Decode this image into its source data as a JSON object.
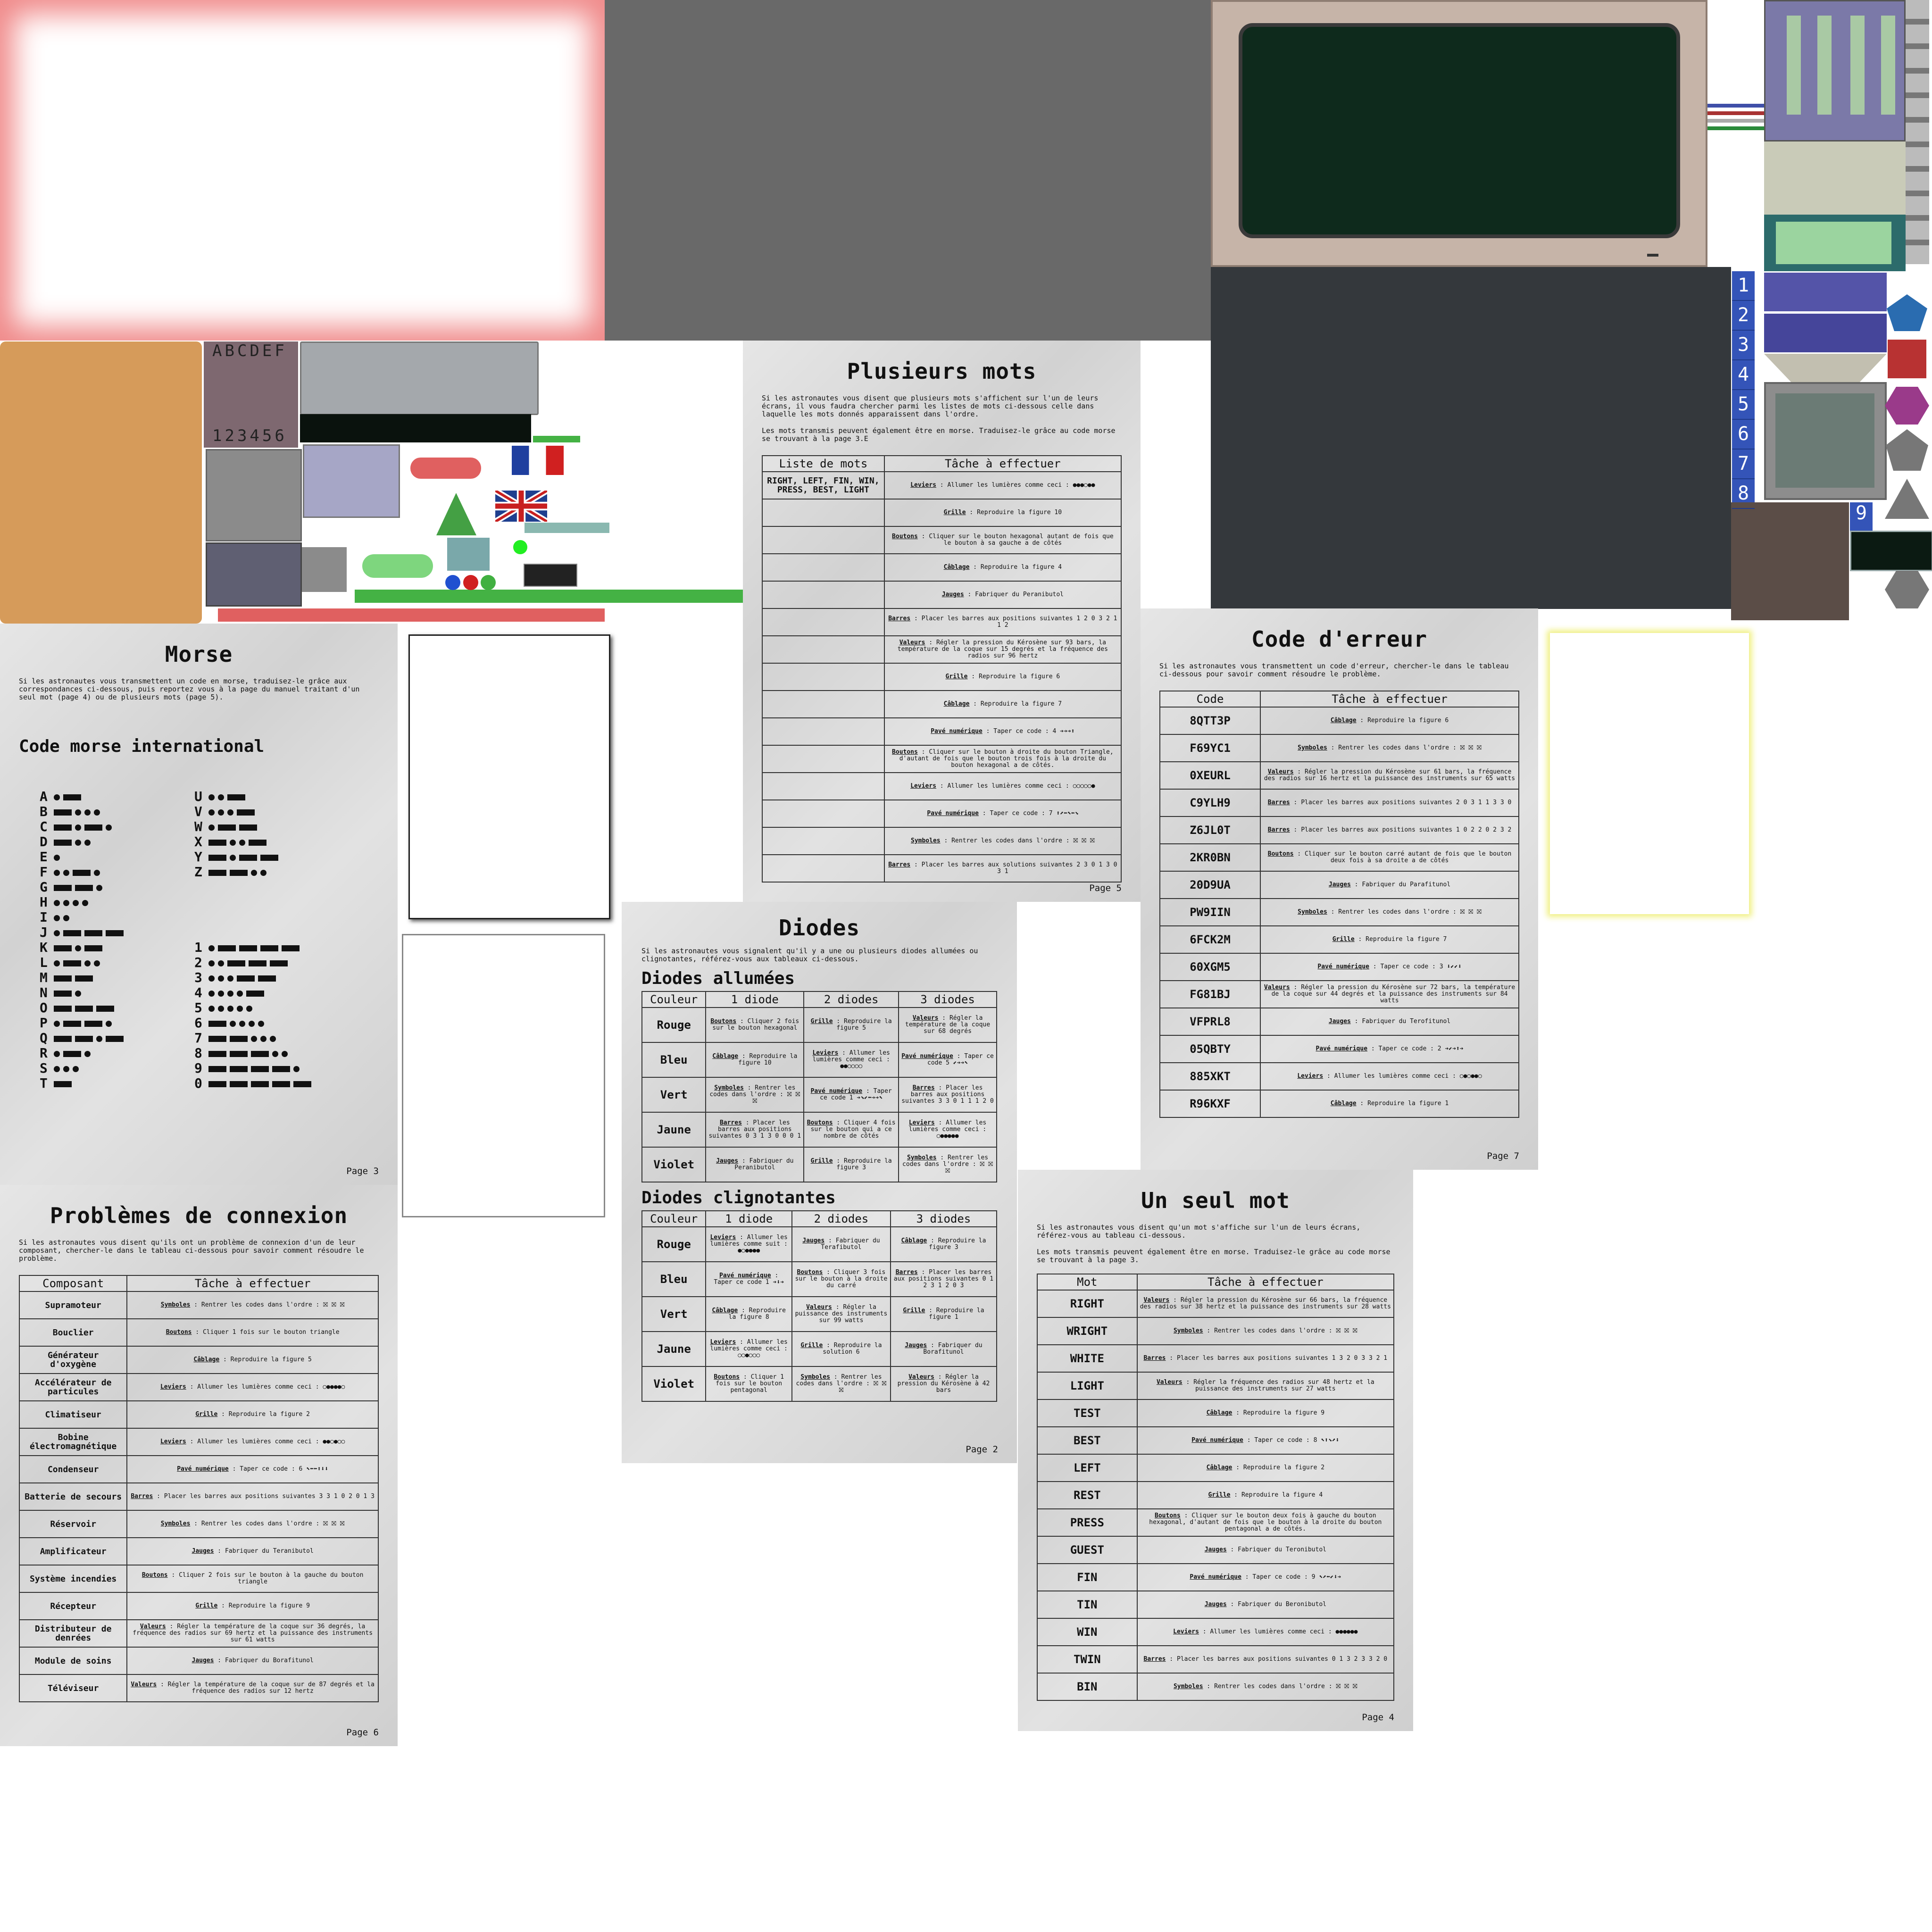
{
  "atlas": {
    "keypad_letters": "ABCDEF",
    "keypad_numbers": "123456",
    "side_numbers": [
      "1",
      "2",
      "3",
      "4",
      "5",
      "6",
      "7",
      "8",
      "9"
    ]
  },
  "morse": {
    "title": "Morse",
    "intro": "Si les astronautes vous transmettent un code en morse, traduisez-le grâce aux correspondances ci-dessous, puis reportez vous à la page du manuel traitant d'un seul mot (page 4) ou de plusieurs mots (page 5).",
    "subtitle": "Code morse international",
    "page": "Page 3",
    "letters_left": [
      "A",
      "B",
      "C",
      "D",
      "E",
      "F",
      "G",
      "H",
      "I",
      "J",
      "K",
      "L",
      "M",
      "N",
      "O",
      "P",
      "Q",
      "R",
      "S",
      "T"
    ],
    "codes_left": [
      ".-",
      "-...",
      "-.-.",
      "-..",
      ".",
      "..-.",
      "--.",
      "....",
      "..",
      ".---",
      "-.-",
      ".-..",
      "--",
      "-.",
      "---",
      ".--.",
      "--.-",
      ".-.",
      "...",
      "-"
    ],
    "letters_right": [
      "U",
      "V",
      "W",
      "X",
      "Y",
      "Z"
    ],
    "codes_right": [
      "..-",
      "...-",
      ".--",
      "-..-",
      "-.--",
      "--.."
    ],
    "digits": [
      "1",
      "2",
      "3",
      "4",
      "5",
      "6",
      "7",
      "8",
      "9",
      "0"
    ],
    "codes_digits": [
      ".----",
      "..---",
      "...--",
      "....-",
      ".....",
      "-....",
      "--...",
      "---..",
      "----.",
      "-----"
    ]
  },
  "connexion": {
    "title": "Problèmes de connexion",
    "intro": "Si les astronautes vous disent qu'ils ont un problème de connexion d'un de leur composant, chercher-le dans le tableau ci-dessous pour savoir comment résoudre le problème.",
    "col1": "Composant",
    "col2": "Tâche à effectuer",
    "page": "Page 6",
    "rows": [
      {
        "k": "Supramoteur",
        "t": "Symboles",
        "d": " : Rentrer les codes dans l'ordre : ⛝ ⛝ ⛝"
      },
      {
        "k": "Bouclier",
        "t": "Boutons",
        "d": " : Cliquer 1 fois sur le bouton triangle"
      },
      {
        "k": "Générateur d'oxygène",
        "t": "Câblage",
        "d": " : Reproduire la figure 5"
      },
      {
        "k": "Accélérateur de particules",
        "t": "Leviers",
        "d": " : Allumer les lumières comme ceci : ○●●●●○"
      },
      {
        "k": "Climatiseur",
        "t": "Grille",
        "d": " : Reproduire la figure 2"
      },
      {
        "k": "Bobine électromagnétique",
        "t": "Leviers",
        "d": " : Allumer les lumières comme ceci : ●●○●○○"
      },
      {
        "k": "Condenseur",
        "t": "Pavé numérique",
        "d": " : Taper ce code : 6 ⬉⬅⬅⬆⬇⬇"
      },
      {
        "k": "Batterie de secours",
        "t": "Barres",
        "d": " : Placer les barres aux positions suivantes 3 3 1 0 2 0 1 3"
      },
      {
        "k": "Réservoir",
        "t": "Symboles",
        "d": " : Rentrer les codes dans l'ordre : ⛝ ⛝ ⛝"
      },
      {
        "k": "Amplificateur",
        "t": "Jauges",
        "d": " : Fabriquer du Teranibutol"
      },
      {
        "k": "Système incendies",
        "t": "Boutons",
        "d": " : Cliquer 2 fois sur le bouton à la gauche du bouton triangle"
      },
      {
        "k": "Récepteur",
        "t": "Grille",
        "d": " : Reproduire la figure 9"
      },
      {
        "k": "Distributeur de denrées",
        "t": "Valeurs",
        "d": " : Régler la température de la coque sur 36 degrés, la fréquence des radios sur 69 hertz et la puissance des instruments sur 61 watts"
      },
      {
        "k": "Module de soins",
        "t": "Jauges",
        "d": " : Fabriquer du Borafitunol"
      },
      {
        "k": "Téléviseur",
        "t": "Valeurs",
        "d": " : Régler la température de la coque sur de 87 degrés et la fréquence des radios sur 12 hertz"
      }
    ]
  },
  "plusieurs": {
    "title": "Plusieurs mots",
    "intro1": "Si les astronautes vous disent que plusieurs mots s'affichent sur l'un de leurs écrans, il vous faudra chercher parmi les listes de mots ci-dessous celle dans laquelle les mots donnés apparaissent dans l'ordre.",
    "intro2": "Les mots transmis peuvent également être en morse. Traduisez-le grâce au code morse se trouvant à la page 3.E",
    "col1": "Liste de mots",
    "col2": "Tâche à effectuer",
    "page": "Page 5",
    "rows": [
      {
        "k": "RIGHT, LEFT, FIN, WIN, PRESS, BEST, LIGHT",
        "t": "Leviers",
        "d": " : Allumer les lumières comme ceci : ●●●○●●"
      },
      {
        "k": "",
        "t": "Grille",
        "d": " : Reproduire la figure 10"
      },
      {
        "k": "",
        "t": "Boutons",
        "d": " : Cliquer sur le bouton hexagonal autant de fois que le bouton à sa gauche a de côtés"
      },
      {
        "k": "",
        "t": "Câblage",
        "d": " : Reproduire la figure 4"
      },
      {
        "k": "",
        "t": "Jauges",
        "d": " : Fabriquer du Peranibutol"
      },
      {
        "k": "",
        "t": "Barres",
        "d": " : Placer les barres aux positions suivantes 1 2 0 3 2 1 1 2"
      },
      {
        "k": "",
        "t": "Valeurs",
        "d": " : Régler la pression du Kérosène sur 93 bars, la température de la coque sur 15 degrés et la fréquence des radios sur 96 hertz"
      },
      {
        "k": "",
        "t": "Grille",
        "d": " : Reproduire la figure 6"
      },
      {
        "k": "",
        "t": "Câblage",
        "d": " : Reproduire la figure 7"
      },
      {
        "k": "",
        "t": "Pavé numérique",
        "d": " : Taper ce code : 4 ➔➔➔⬆"
      },
      {
        "k": "",
        "t": "Boutons",
        "d": " : Cliquer sur le bouton à droite du bouton Triangle, d'autant de fois que le bouton trois fois à la droite du bouton hexagonal a de côtés."
      },
      {
        "k": "",
        "t": "Leviers",
        "d": " : Allumer les lumières comme ceci : ○○○○○●"
      },
      {
        "k": "",
        "t": "Pavé numérique",
        "d": " : Taper ce code : 7 ⬆⬈⬅⬉⬅⬊"
      },
      {
        "k": "",
        "t": "Symboles",
        "d": " : Rentrer les codes dans l'ordre : ⛝ ⛝ ⛝"
      },
      {
        "k": "",
        "t": "Barres",
        "d": " : Placer les barres aux solutions suivantes 2 3 0 1 3 0 3 1"
      }
    ]
  },
  "diodes": {
    "title": "Diodes",
    "intro": "Si les astronautes vous signalent qu'il y a une ou plusieurs diodes allumées ou clignotantes, référez-vous aux tableaux ci-dessous.",
    "sub1": "Diodes allumées",
    "sub2": "Diodes clignotantes",
    "cols": [
      "Couleur",
      "1 diode",
      "2 diodes",
      "3 diodes"
    ],
    "page": "Page 2",
    "lit": [
      {
        "k": "Rouge",
        "c": [
          [
            "Boutons",
            " : Cliquer 2 fois sur le bouton hexagonal"
          ],
          [
            "Grille",
            " : Reproduire la figure 5"
          ],
          [
            "Valeurs",
            " : Régler la température de la coque sur 68 degrés"
          ]
        ]
      },
      {
        "k": "Bleu",
        "c": [
          [
            "Câblage",
            " : Reproduire la figure 10"
          ],
          [
            "Leviers",
            " : Allumer les lumières comme ceci : ●●○○○○"
          ],
          [
            "Pavé numérique",
            " : Taper ce code 5 ⬋➔➔⬉"
          ]
        ]
      },
      {
        "k": "Vert",
        "c": [
          [
            "Symboles",
            " : Rentrer les codes dans l'ordre : ⛝ ⛝ ⛝"
          ],
          [
            "Pavé numérique",
            " : Taper ce code 1 ➔⬊⬋⬅➔➔⬉"
          ],
          [
            "Barres",
            " : Placer les barres aux positions suivantes 3 3 0 1 1 1 2 0"
          ]
        ]
      },
      {
        "k": "Jaune",
        "c": [
          [
            "Barres",
            " : Placer les barres aux positions suivantes 0 3 1 3 0 0 0 1"
          ],
          [
            "Boutons",
            " : Cliquer 4 fois sur le bouton qui a ce nombre de côtés"
          ],
          [
            "Leviers",
            " : Allumer les lumières comme ceci : ○●●●●●"
          ]
        ]
      },
      {
        "k": "Violet",
        "c": [
          [
            "Jauges",
            " : Fabriquer du Peranibutol"
          ],
          [
            "Grille",
            " : Reproduire la figure 3"
          ],
          [
            "Symboles",
            " : Rentrer les codes dans l'ordre : ⛝ ⛝ ⛝"
          ]
        ]
      }
    ],
    "blink": [
      {
        "k": "Rouge",
        "c": [
          [
            "Leviers",
            " : Allumer les lumières comme suit : ●○●●●●"
          ],
          [
            "Jauges",
            " : Fabriquer du Terafibutol"
          ],
          [
            "Câblage",
            " : Reproduire la figure 3"
          ]
        ]
      },
      {
        "k": "Bleu",
        "c": [
          [
            "Pavé numérique",
            " : Taper ce code 1 ➔⬇➔"
          ],
          [
            "Boutons",
            " : Cliquer 3 fois sur le bouton à la droite du carré"
          ],
          [
            "Barres",
            " : Placer les barres aux positions suivantes 0 1 2 3 1 2 0 3"
          ]
        ]
      },
      {
        "k": "Vert",
        "c": [
          [
            "Câblage",
            " : Reproduire la figure 8"
          ],
          [
            "Valeurs",
            " : Régler la puissance des instruments sur 99 watts"
          ],
          [
            "Grille",
            " : Reproduire la figure 1"
          ]
        ]
      },
      {
        "k": "Jaune",
        "c": [
          [
            "Leviers",
            " : Allumer les lumières comme ceci : ○○●○○○"
          ],
          [
            "Grille",
            " : Reproduire la solution 6"
          ],
          [
            "Jauges",
            " : Fabriquer du Borafitunol"
          ]
        ]
      },
      {
        "k": "Violet",
        "c": [
          [
            "Boutons",
            " : Cliquer 1 fois sur le bouton pentagonal"
          ],
          [
            "Symboles",
            " : Rentrer les codes dans l'ordre : ⛝ ⛝ ⛝"
          ],
          [
            "Valeurs",
            " : Régler la pression du Kérosène à 42 bars"
          ]
        ]
      }
    ]
  },
  "erreur": {
    "title": "Code d'erreur",
    "intro": "Si les astronautes vous transmettent un code d'erreur, chercher-le dans le tableau ci-dessous pour savoir comment résoudre le problème.",
    "col1": "Code",
    "col2": "Tâche à effectuer",
    "page": "Page 7",
    "rows": [
      {
        "k": "8QTT3P",
        "t": "Câblage",
        "d": " : Reproduire la figure 6"
      },
      {
        "k": "F69YC1",
        "t": "Symboles",
        "d": " : Rentrer les codes dans l'ordre : ⛝ ⛝ ⛝"
      },
      {
        "k": "0XEURL",
        "t": "Valeurs",
        "d": " : Régler la pression du Kérosène sur 61 bars, la fréquence des radios sur 16 hertz et la puissance des instruments sur 65 watts"
      },
      {
        "k": "C9YLH9",
        "t": "Barres",
        "d": " : Placer les barres aux positions suivantes 2 0 3 1 1 3 3 0"
      },
      {
        "k": "Z6JL0T",
        "t": "Barres",
        "d": " : Placer les barres aux positions suivantes 1 0 2 2 0 2 3 2"
      },
      {
        "k": "2KR0BN",
        "t": "Boutons",
        "d": " : Cliquer sur le bouton carré autant de fois que le bouton deux fois à sa droite a de côtés"
      },
      {
        "k": "20D9UA",
        "t": "Jauges",
        "d": " : Fabriquer du Parafitunol"
      },
      {
        "k": "PW9IIN",
        "t": "Symboles",
        "d": " : Rentrer les codes dans l'ordre : ⛝ ⛝ ⛝"
      },
      {
        "k": "6FCK2M",
        "t": "Grille",
        "d": " : Reproduire la figure 7"
      },
      {
        "k": "60XGM5",
        "t": "Pavé numérique",
        "d": " : Taper ce code : 3 ⬇⬋⬋⬇"
      },
      {
        "k": "FG81BJ",
        "t": "Valeurs",
        "d": " : Régler la pression du Kérosène sur 72 bars, la température de la coque sur 44 degrés et la puissance des instruments sur 84 watts"
      },
      {
        "k": "VFPRL8",
        "t": "Jauges",
        "d": " : Fabriquer du Terofitunol"
      },
      {
        "k": "05QBTY",
        "t": "Pavé numérique",
        "d": " : Taper ce code : 2 ➔⬋➔⬆➔"
      },
      {
        "k": "885XKT",
        "t": "Leviers",
        "d": " : Allumer les lumières comme ceci : ○●○●●○"
      },
      {
        "k": "R96KXF",
        "t": "Câblage",
        "d": " : Reproduire la figure 1"
      }
    ]
  },
  "seul": {
    "title": "Un seul mot",
    "intro1": "Si les astronautes vous disent qu'un mot s'affiche sur l'un de leurs écrans, référez-vous au tableau ci-dessous.",
    "intro2": "Les mots transmis peuvent également être en morse. Traduisez-le grâce au code morse se trouvant à la page 3.",
    "col1": "Mot",
    "col2": "Tâche à effectuer",
    "page": "Page 4",
    "rows": [
      {
        "k": "RIGHT",
        "t": "Valeurs",
        "d": " : Régler la pression du Kérosène sur 66 bars, la fréquence des radios sur 38 hertz et la puissance des instruments sur 28 watts"
      },
      {
        "k": "WRIGHT",
        "t": "Symboles",
        "d": " : Rentrer les codes dans l'ordre : ⛝ ⛝ ⛝"
      },
      {
        "k": "WHITE",
        "t": "Barres",
        "d": " : Placer les barres aux positions suivantes 1 3 2 0 3 3 2 1"
      },
      {
        "k": "LIGHT",
        "t": "Valeurs",
        "d": " : Régler la fréquence des radios sur 48 hertz et la puissance des instruments sur 27 watts"
      },
      {
        "k": "TEST",
        "t": "Câblage",
        "d": " : Reproduire la figure 9"
      },
      {
        "k": "BEST",
        "t": "Pavé numérique",
        "d": " : Taper ce code : 8 ⬉⬆⬊⬈⬇"
      },
      {
        "k": "LEFT",
        "t": "Câblage",
        "d": " : Reproduire la figure 2"
      },
      {
        "k": "REST",
        "t": "Grille",
        "d": " : Reproduire la figure 4"
      },
      {
        "k": "PRESS",
        "t": "Boutons",
        "d": " : Cliquer sur le bouton deux fois à gauche du bouton hexagonal, d'autant de fois que le bouton à la droite du bouton pentagonal a de côtés."
      },
      {
        "k": "GUEST",
        "t": "Jauges",
        "d": " : Fabriquer du Teronibutol"
      },
      {
        "k": "FIN",
        "t": "Pavé numérique",
        "d": " : Taper ce code : 9 ⬉⬈⬅⬋⬇➔"
      },
      {
        "k": "TIN",
        "t": "Jauges",
        "d": " : Fabriquer du Beronibutol"
      },
      {
        "k": "WIN",
        "t": "Leviers",
        "d": " : Allumer les lumières comme ceci : ●●●●●●"
      },
      {
        "k": "TWIN",
        "t": "Barres",
        "d": " : Placer les barres aux positions suivantes 0 1 3 2 3 3 2 0"
      },
      {
        "k": "BIN",
        "t": "Symboles",
        "d": " : Rentrer les codes dans l'ordre : ⛝ ⛝ ⛝"
      }
    ]
  }
}
